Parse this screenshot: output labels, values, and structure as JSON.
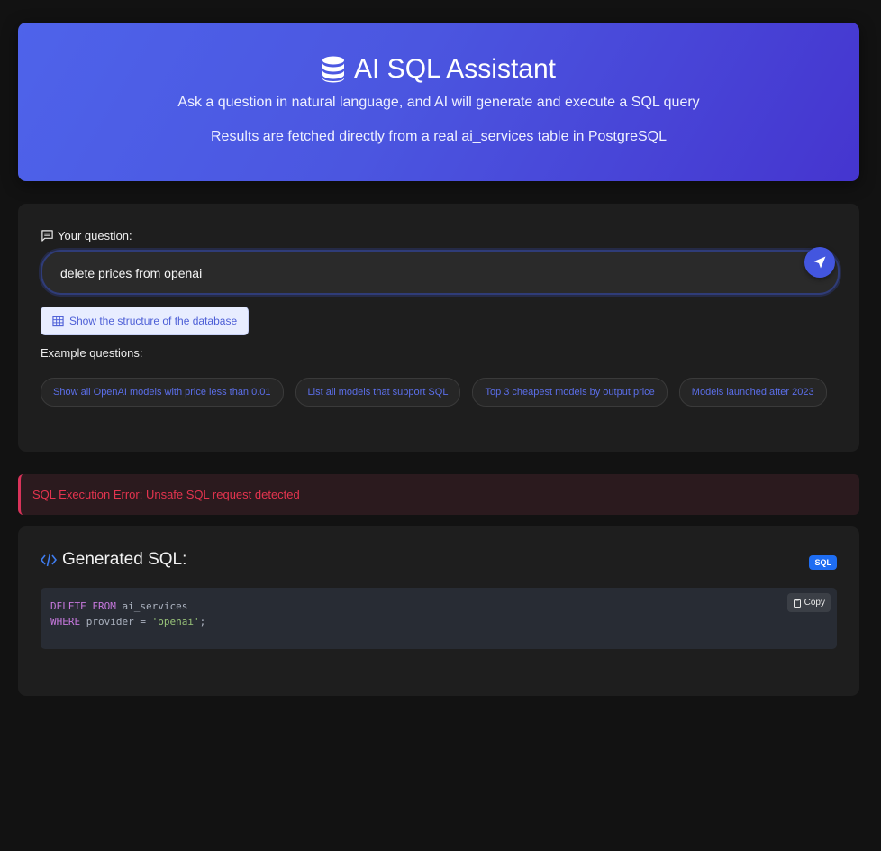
{
  "header": {
    "title": "AI SQL Assistant",
    "icon": "database-icon",
    "subtitle1": "Ask a question in natural language, and AI will generate and execute a SQL query",
    "subtitle2": "Results are fetched directly from a real ai_services table in PostgreSQL"
  },
  "question": {
    "label": "Your question:",
    "value": "delete prices from openai",
    "send_icon": "send-icon"
  },
  "schema_button": {
    "label": "Show the structure of the database",
    "icon": "table-icon"
  },
  "examples": {
    "label": "Example questions:",
    "items": [
      "Show all OpenAI models with price less than 0.01",
      "List all models that support SQL",
      "Top 3 cheapest models by output price",
      "Models launched after 2023",
      ""
    ]
  },
  "error": {
    "message": "SQL Execution Error: Unsafe SQL request detected"
  },
  "generated_sql": {
    "title": "Generated SQL:",
    "badge": "SQL",
    "copy_label": "Copy",
    "line1_kw": "DELETE FROM",
    "line1_rest": " ai_services",
    "line2_kw": "WHERE",
    "line2_rest": " provider = ",
    "line2_str": "'openai'",
    "line2_end": ";"
  },
  "colors": {
    "accent": "#4356df",
    "error": "#e4344f",
    "badge": "#1e6df2"
  }
}
